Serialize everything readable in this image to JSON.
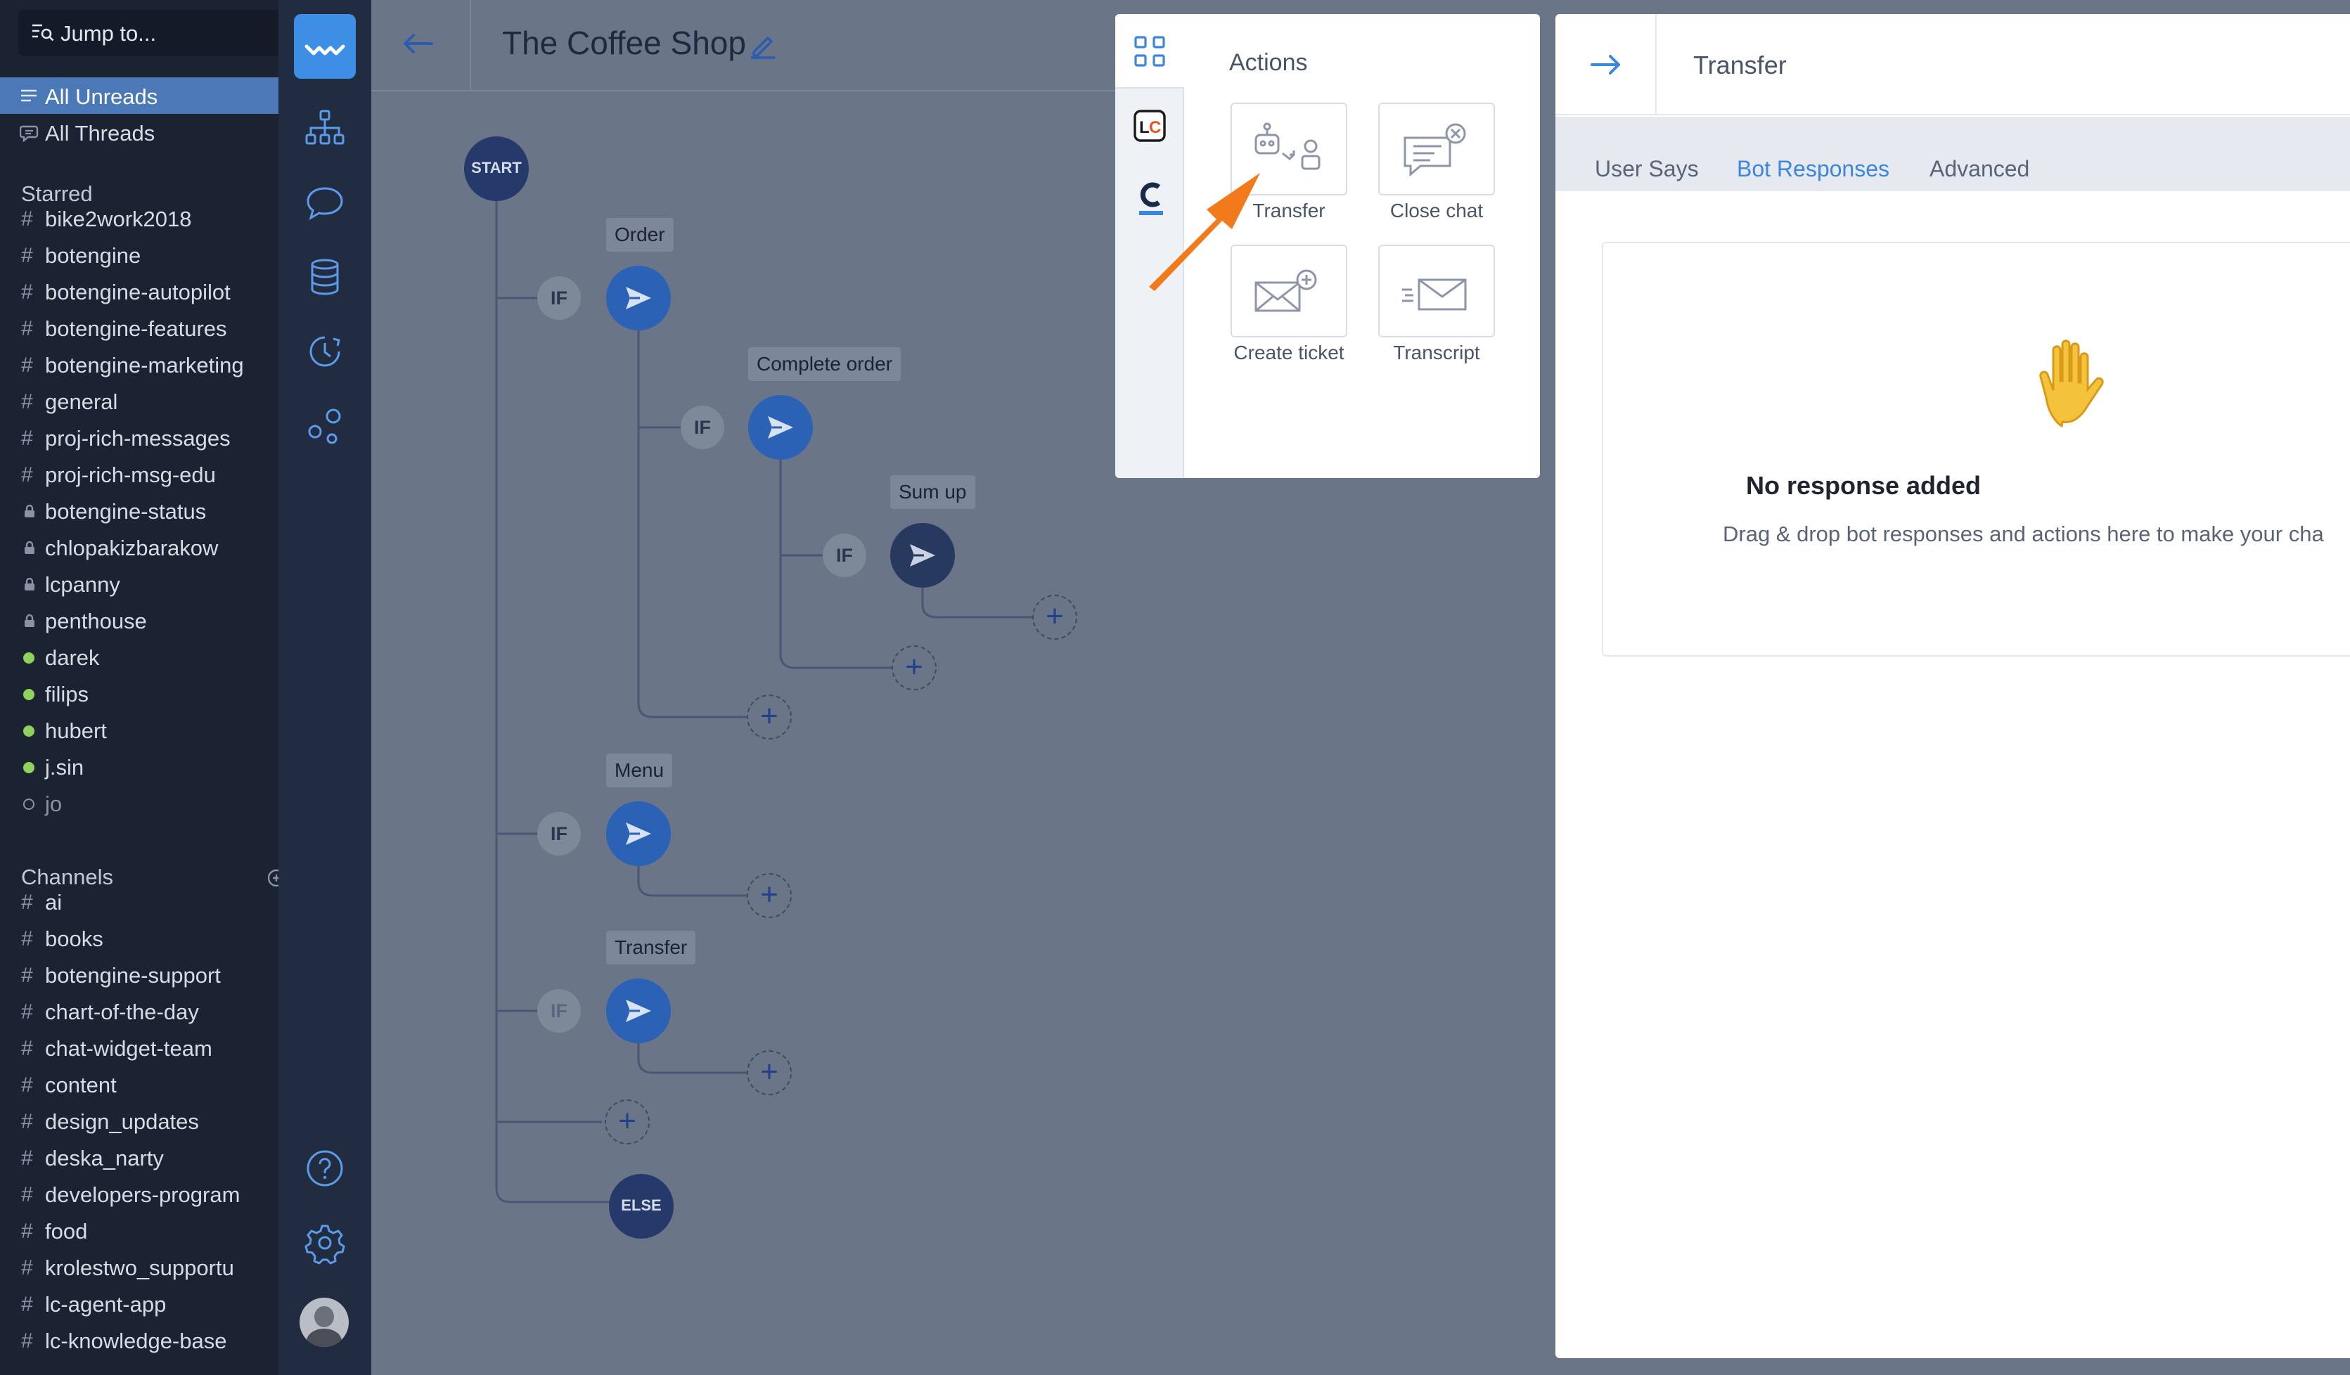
{
  "slack": {
    "jump_label": "Jump to...",
    "top_items": [
      {
        "label": "All Unreads",
        "active": true
      },
      {
        "label": "All Threads",
        "active": false
      }
    ],
    "starred_header": "Starred",
    "starred": [
      {
        "prefix": "#",
        "label": "bike2work2018"
      },
      {
        "prefix": "#",
        "label": "botengine"
      },
      {
        "prefix": "#",
        "label": "botengine-autopilot"
      },
      {
        "prefix": "#",
        "label": "botengine-features"
      },
      {
        "prefix": "#",
        "label": "botengine-marketing"
      },
      {
        "prefix": "#",
        "label": "general"
      },
      {
        "prefix": "#",
        "label": "proj-rich-messages"
      },
      {
        "prefix": "#",
        "label": "proj-rich-msg-edu"
      },
      {
        "prefix": "lock",
        "label": "botengine-status"
      },
      {
        "prefix": "lock",
        "label": "chlopakizbarakow"
      },
      {
        "prefix": "lock",
        "label": "lcpanny"
      },
      {
        "prefix": "lock",
        "label": "penthouse"
      },
      {
        "prefix": "online",
        "label": "darek"
      },
      {
        "prefix": "online",
        "label": "filips"
      },
      {
        "prefix": "online",
        "label": "hubert"
      },
      {
        "prefix": "online",
        "label": "j.sin"
      },
      {
        "prefix": "offline",
        "label": "jo"
      }
    ],
    "channels_header": "Channels",
    "channels": [
      {
        "prefix": "#",
        "label": "ai"
      },
      {
        "prefix": "#",
        "label": "books"
      },
      {
        "prefix": "#",
        "label": "botengine-support"
      },
      {
        "prefix": "#",
        "label": "chart-of-the-day"
      },
      {
        "prefix": "#",
        "label": "chat-widget-team"
      },
      {
        "prefix": "#",
        "label": "content"
      },
      {
        "prefix": "#",
        "label": "design_updates"
      },
      {
        "prefix": "#",
        "label": "deska_narty"
      },
      {
        "prefix": "#",
        "label": "developers-program"
      },
      {
        "prefix": "#",
        "label": "food"
      },
      {
        "prefix": "#",
        "label": "krolestwo_supportu"
      },
      {
        "prefix": "#",
        "label": "lc-agent-app"
      },
      {
        "prefix": "#",
        "label": "lc-knowledge-base"
      }
    ]
  },
  "rail": {
    "icons": [
      "logo-wave-icon",
      "story-tree-icon",
      "chat-bubble-icon",
      "database-icon",
      "history-clock-icon",
      "integrations-icon",
      "help-icon",
      "settings-gear-icon",
      "user-avatar"
    ]
  },
  "story": {
    "title": "The Coffee Shop",
    "start_label": "START",
    "else_label": "ELSE",
    "if_label": "IF",
    "plus_label": "+",
    "nodes": {
      "order": "Order",
      "complete_order": "Complete order",
      "sum_up": "Sum up",
      "menu": "Menu",
      "transfer": "Transfer"
    }
  },
  "actions_panel": {
    "heading": "Actions",
    "tabs": [
      "grid-icon",
      "livechat-lc-icon",
      "chatbot-c-icon"
    ],
    "cards": [
      {
        "label": "Transfer",
        "icon": "bot-to-agent-icon"
      },
      {
        "label": "Close chat",
        "icon": "close-chat-icon"
      },
      {
        "label": "Create ticket",
        "icon": "create-ticket-icon"
      },
      {
        "label": "Transcript",
        "icon": "transcript-icon"
      }
    ],
    "arrow_color": "#f27a1a"
  },
  "transfer_panel": {
    "title": "Transfer",
    "tabs": [
      {
        "label": "User Says",
        "selected": false
      },
      {
        "label": "Bot Responses",
        "selected": true
      },
      {
        "label": "Advanced",
        "selected": false
      }
    ],
    "empty_emoji": "✋",
    "empty_title": "No response added",
    "empty_hint": "Drag & drop bot responses and actions here to make your cha"
  },
  "colors": {
    "accent": "#3a86e0",
    "node_blue": "#2b62b5",
    "canvas": "#6a7588",
    "sidebar": "#1b2232",
    "rail": "#222c41",
    "active_row": "#4b79b8"
  }
}
